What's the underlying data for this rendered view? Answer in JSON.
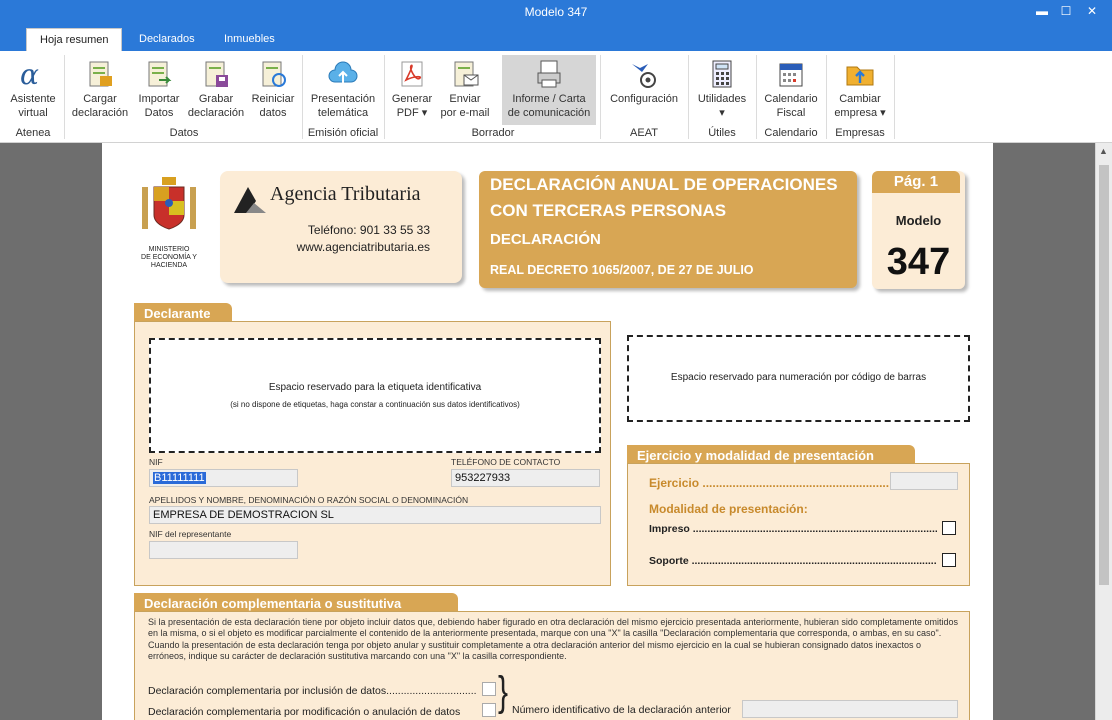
{
  "window": {
    "title": "Modelo 347"
  },
  "tabs": [
    {
      "label": "Hoja resumen"
    },
    {
      "label": "Declarados"
    },
    {
      "label": "Inmuebles"
    }
  ],
  "ribbon": {
    "buttons": [
      {
        "label1": "Asistente",
        "label2": "virtual"
      },
      {
        "label1": "Cargar",
        "label2": "declaración"
      },
      {
        "label1": "Importar",
        "label2": "Datos"
      },
      {
        "label1": "Grabar",
        "label2": "declaración"
      },
      {
        "label1": "Reiniciar",
        "label2": "datos"
      },
      {
        "label1": "Presentación",
        "label2": "telemática"
      },
      {
        "label1": "Generar",
        "label2": "PDF ▾"
      },
      {
        "label1": "Enviar",
        "label2": "por e-mail"
      },
      {
        "label1": "Informe / Carta",
        "label2": "de comunicación"
      },
      {
        "label1": "Configuración",
        "label2": ""
      },
      {
        "label1": "Utilidades",
        "label2": "▾"
      },
      {
        "label1": "Calendario",
        "label2": "Fiscal"
      },
      {
        "label1": "Cambiar",
        "label2": "empresa ▾"
      }
    ],
    "groups": [
      "Atenea",
      "Datos",
      "Emisión oficial",
      "Borrador",
      "AEAT",
      "Útiles",
      "Calendario",
      "Empresas"
    ]
  },
  "form": {
    "ministry": {
      "l1": "MINISTERIO",
      "l2": "DE ECONOMÍA Y",
      "l3": "HACIENDA"
    },
    "agency": {
      "name": "Agencia Tributaria",
      "phone": "Teléfono: 901 33 55 33",
      "web": "www.agenciatributaria.es"
    },
    "title": {
      "l1": "DECLARACIÓN ANUAL DE OPERACIONES",
      "l2": "CON TERCERAS PERSONAS",
      "l3": "DECLARACIÓN",
      "l4": "REAL DECRETO 1065/2007, DE 27 DE JULIO"
    },
    "page": {
      "pag": "Pág. 1",
      "modelo": "Modelo",
      "num": "347"
    },
    "declarante": {
      "header": "Declarante",
      "label_space": "Espacio reservado para la etiqueta identificativa",
      "label_space_note": "(si no dispone de etiquetas, haga constar a continuación sus datos identificativos)",
      "nif_label": "NIF",
      "nif_value": "B11111111",
      "phone_label": "TELÉFONO DE CONTACTO",
      "phone_value": "953227933",
      "name_label": "APELLIDOS Y NOMBRE, DENOMINACIÓN O RAZÓN SOCIAL O DENOMINACIÓN",
      "name_value": "EMPRESA DE DEMOSTRACION SL",
      "rep_label": "NIF del representante",
      "rep_value": ""
    },
    "barcode": "Espacio reservado para numeración por código de barras",
    "ejercicio": {
      "header": "Ejercicio y modalidad de presentación",
      "ejercicio_label": "Ejercicio ..........................................................",
      "modalidad_label": "Modalidad de presentación:",
      "impreso": "Impreso ............................................................................................................",
      "soporte": "Soporte ............................................................................................................"
    },
    "complementaria": {
      "header": "Declaración complementaria o sustitutiva",
      "p1": "Si la presentación de esta declaración tiene por objeto incluir datos que, debiendo haber figurado en otra declaración del mismo ejercicio presentada anteriormente, hubieran sido completamente omitidos en la misma, o si el  objeto es modificar parcialmente el contenido de la anteriormente presentada, marque con una \"X\" la casilla \"Declaración complementaria que corresponda, o ambas, en su caso\".",
      "p2": "Cuando la presentación de esta declaración tenga por objeto anular y sustituir completamente a otra declaración anterior del mismo ejercicio en la cual se hubieran consignado datos inexactos o erróneos, indique su carácter de declaración sustitutiva marcando con una \"X\" la casilla correspondiente.",
      "inclusion": "Declaración complementaria por inclusión de datos...............................",
      "modificacion": "Declaración complementaria por modificación o anulación de datos",
      "num_label": "Número identificativo de la declaración anterior"
    }
  },
  "colors": {
    "accent": "#2b79d8",
    "form_orange": "#d8a654",
    "form_bg": "#fcecd6"
  }
}
